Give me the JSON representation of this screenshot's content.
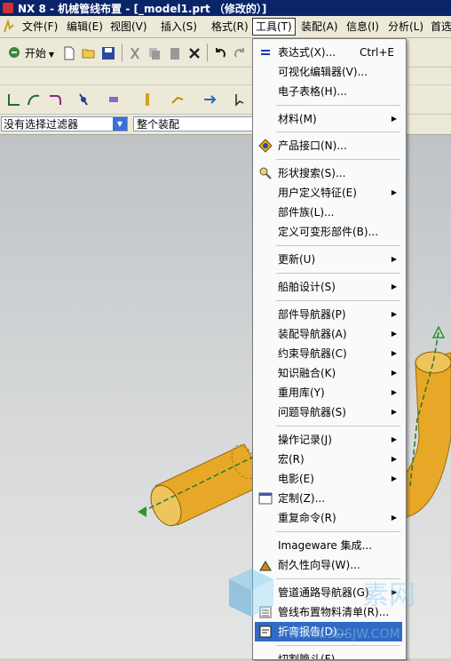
{
  "window": {
    "title": "NX 8 - 机械管线布置 - [_model1.prt （修改的）]"
  },
  "menubar": {
    "items": [
      {
        "label": "文件(F)"
      },
      {
        "label": "编辑(E)"
      },
      {
        "label": "视图(V)"
      },
      {
        "label": "插入(S)"
      },
      {
        "label": "格式(R)"
      },
      {
        "label": "工具(T)"
      },
      {
        "label": "装配(A)"
      },
      {
        "label": "信息(I)"
      },
      {
        "label": "分析(L)"
      },
      {
        "label": "首选"
      }
    ],
    "active_index": 5
  },
  "toolbar": {
    "start_label": "开始"
  },
  "selection_bar": {
    "filter_value": "没有选择过滤器",
    "scope_value": "整个装配"
  },
  "tools_menu": {
    "items": [
      {
        "label": "表达式(X)...",
        "shortcut": "Ctrl+E",
        "icon": "equals-icon"
      },
      {
        "label": "可视化编辑器(V)..."
      },
      {
        "label": "电子表格(H)..."
      },
      {
        "label": "材料(M)",
        "submenu": true
      },
      {
        "label": "产品接口(N)...",
        "icon": "product-interface-icon"
      },
      {
        "label": "形状搜索(S)...",
        "icon": "shape-search-icon"
      },
      {
        "label": "用户定义特征(E)",
        "submenu": true
      },
      {
        "label": "部件族(L)..."
      },
      {
        "label": "定义可变形部件(B)..."
      },
      {
        "label": "更新(U)",
        "submenu": true
      },
      {
        "label": "船舶设计(S)",
        "submenu": true
      },
      {
        "label": "部件导航器(P)",
        "submenu": true
      },
      {
        "label": "装配导航器(A)",
        "submenu": true
      },
      {
        "label": "约束导航器(C)",
        "submenu": true
      },
      {
        "label": "知识融合(K)",
        "submenu": true
      },
      {
        "label": "重用库(Y)",
        "submenu": true
      },
      {
        "label": "问题导航器(S)",
        "submenu": true
      },
      {
        "label": "操作记录(J)",
        "submenu": true
      },
      {
        "label": "宏(R)",
        "submenu": true
      },
      {
        "label": "电影(E)",
        "submenu": true
      },
      {
        "label": "定制(Z)...",
        "icon": "customize-icon"
      },
      {
        "label": "重复命令(R)",
        "submenu": true
      },
      {
        "label": "Imageware 集成..."
      },
      {
        "label": "耐久性向导(W)...",
        "icon": "durability-icon"
      },
      {
        "label": "管道通路导航器(G)",
        "submenu": true
      },
      {
        "label": "管线布置物料清单(R)...",
        "icon": "bom-icon"
      },
      {
        "label": "折弯报告(D)...",
        "icon": "bend-report-icon",
        "highlighted": true
      },
      {
        "label": "切割管斗(F)..."
      }
    ]
  },
  "watermark": {
    "text": "WWW.3DSJW.COM",
    "brand": "素网"
  },
  "colors": {
    "pipe": "#e8a827",
    "menu_highlight": "#316ac5",
    "title_bar": "#0a246a"
  }
}
